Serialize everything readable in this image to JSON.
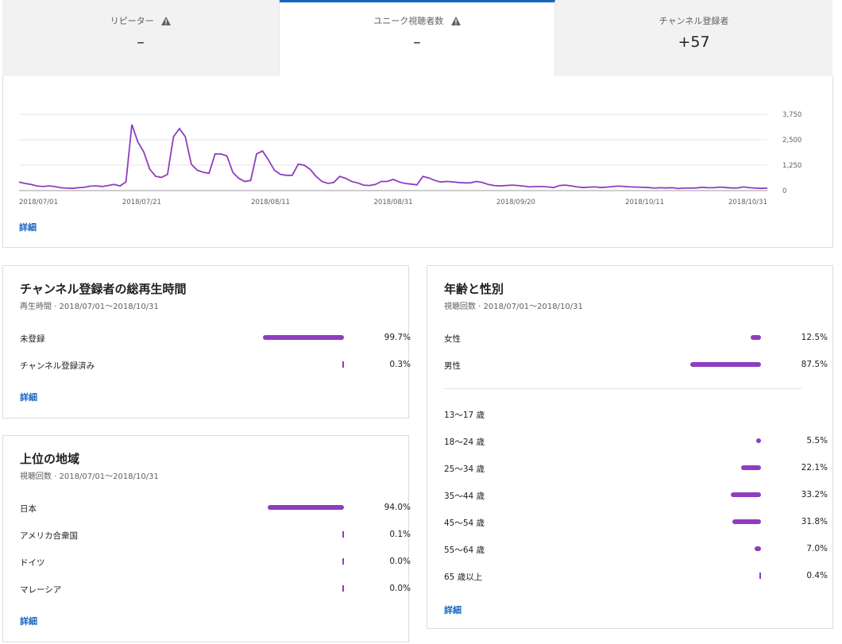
{
  "metrics": [
    {
      "title": "リピーター",
      "value": "–",
      "warning": true
    },
    {
      "title": "ユニーク視聴者数",
      "value": "–",
      "warning": true
    },
    {
      "title": "チャンネル登録者",
      "value": "+57",
      "warning": false
    }
  ],
  "main_chart": {
    "details_link": "詳細"
  },
  "chart_data": {
    "type": "line",
    "y_ticks": [
      "3,750",
      "2,500",
      "1,250",
      "0"
    ],
    "ylim": [
      0,
      3750
    ],
    "x_ticks": [
      "2018/07/01",
      "2018/07/21",
      "2018/08/11",
      "2018/08/31",
      "2018/09/20",
      "2018/10/11",
      "2018/10/31"
    ],
    "color": "#8e3dbf",
    "values": [
      420,
      350,
      300,
      230,
      200,
      230,
      200,
      140,
      120,
      110,
      140,
      160,
      220,
      230,
      200,
      250,
      300,
      230,
      430,
      3250,
      2400,
      1900,
      1050,
      700,
      650,
      800,
      2650,
      3050,
      2650,
      1300,
      1000,
      900,
      850,
      1800,
      1800,
      1700,
      900,
      600,
      450,
      500,
      1800,
      1950,
      1500,
      1000,
      800,
      750,
      750,
      1300,
      1250,
      1050,
      700,
      450,
      350,
      400,
      700,
      600,
      450,
      380,
      270,
      250,
      300,
      450,
      450,
      550,
      420,
      350,
      320,
      280,
      700,
      620,
      500,
      420,
      450,
      430,
      400,
      380,
      380,
      450,
      400,
      300,
      250,
      230,
      250,
      270,
      250,
      220,
      180,
      200,
      200,
      180,
      150,
      250,
      270,
      230,
      180,
      150,
      170,
      180,
      150,
      170,
      200,
      220,
      200,
      180,
      170,
      160,
      150,
      120,
      140,
      130,
      140,
      100,
      120,
      120,
      130,
      160,
      140,
      140,
      170,
      150,
      130,
      130,
      180,
      140,
      120,
      110,
      120
    ]
  },
  "watch_time": {
    "title": "チャンネル登録者の総再生時間",
    "subtitle": "再生時間 · 2018/07/01〜2018/10/31",
    "rows": [
      {
        "label": "未登録",
        "value": "99.7%",
        "pct": 99.7
      },
      {
        "label": "チャンネル登録済み",
        "value": "0.3%",
        "pct": 0.3
      }
    ],
    "details_link": "詳細"
  },
  "regions": {
    "title": "上位の地域",
    "subtitle": "視聴回数 · 2018/07/01〜2018/10/31",
    "rows": [
      {
        "label": "日本",
        "value": "94.0%",
        "pct": 94.0
      },
      {
        "label": "アメリカ合衆国",
        "value": "0.1%",
        "pct": 0.1
      },
      {
        "label": "ドイツ",
        "value": "0.0%",
        "pct": 0.0
      },
      {
        "label": "マレーシア",
        "value": "0.0%",
        "pct": 0.0
      }
    ],
    "details_link": "詳細"
  },
  "age_gender": {
    "title": "年齢と性別",
    "subtitle": "視聴回数 · 2018/07/01〜2018/10/31",
    "gender_rows": [
      {
        "label": "女性",
        "value": "12.5%",
        "pct": 12.5
      },
      {
        "label": "男性",
        "value": "87.5%",
        "pct": 87.5
      }
    ],
    "age_rows": [
      {
        "label": "13〜17 歳",
        "value": "",
        "pct": 0
      },
      {
        "label": "18〜24 歳",
        "value": "5.5%",
        "pct": 5.5
      },
      {
        "label": "25〜34 歳",
        "value": "22.1%",
        "pct": 22.1
      },
      {
        "label": "35〜44 歳",
        "value": "33.2%",
        "pct": 33.2
      },
      {
        "label": "45〜54 歳",
        "value": "31.8%",
        "pct": 31.8
      },
      {
        "label": "55〜64 歳",
        "value": "7.0%",
        "pct": 7.0
      },
      {
        "label": "65 歳以上",
        "value": "0.4%",
        "pct": 0.4
      }
    ],
    "details_link": "詳細"
  }
}
